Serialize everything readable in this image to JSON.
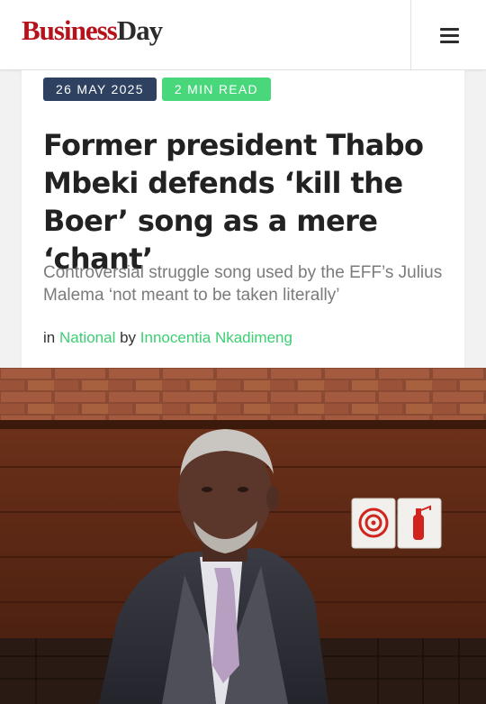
{
  "header": {
    "logo_part1": "Business",
    "logo_part2": "Day",
    "menu_icon": "hamburger-menu-icon"
  },
  "article": {
    "date": "26 MAY 2025",
    "read_time": "2 MIN READ",
    "headline": "Former president Thabo Mbeki defends ‘kill the Boer’ song as a mere ‘chant’",
    "subheadline": "Controversial struggle song used by the EFF’s Julius Malema ‘not meant to be taken literally’",
    "byline_in": "in",
    "category": "National",
    "byline_by": "by",
    "author": "Innocentia Nkadimeng"
  },
  "photo": {
    "signs": [
      "fire-hose-reel-sign-icon",
      "fire-extinguisher-sign-icon"
    ]
  },
  "colors": {
    "brand_red": "#b5121b",
    "date_badge": "#2e4160",
    "accent_green": "#49d77c",
    "link_green": "#3ccf72"
  }
}
